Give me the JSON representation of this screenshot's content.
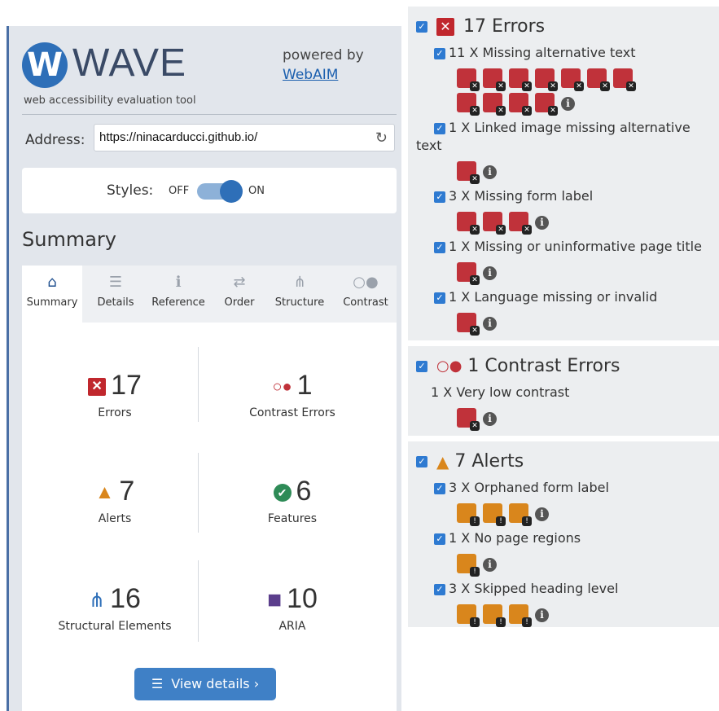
{
  "brand": {
    "logo_letter": "W",
    "title": "WAVE",
    "tagline": "web accessibility evaluation tool",
    "powered_by": "powered by",
    "webaim_link": "WebAIM"
  },
  "address": {
    "label": "Address:",
    "value": "https://ninacarducci.github.io/"
  },
  "styles": {
    "label": "Styles:",
    "off": "OFF",
    "on": "ON",
    "state": "on"
  },
  "summary_heading": "Summary",
  "tabs": [
    {
      "label": "Summary",
      "icon": "home-icon",
      "glyph": "⌂"
    },
    {
      "label": "Details",
      "icon": "list-icon",
      "glyph": "☰"
    },
    {
      "label": "Reference",
      "icon": "info-icon",
      "glyph": "ℹ"
    },
    {
      "label": "Order",
      "icon": "order-icon",
      "glyph": "⇄"
    },
    {
      "label": "Structure",
      "icon": "structure-icon",
      "glyph": "⋔"
    },
    {
      "label": "Contrast",
      "icon": "contrast-icon",
      "glyph": "○●"
    }
  ],
  "stats": {
    "errors": {
      "value": "17",
      "label": "Errors",
      "glyph": "✕"
    },
    "contrast": {
      "value": "1",
      "label": "Contrast Errors",
      "glyph": "○●"
    },
    "alerts": {
      "value": "7",
      "label": "Alerts",
      "glyph": "▲"
    },
    "features": {
      "value": "6",
      "label": "Features",
      "glyph": "✔"
    },
    "structural": {
      "value": "16",
      "label": "Structural Elements",
      "glyph": "⋔"
    },
    "aria": {
      "value": "10",
      "label": "ARIA",
      "glyph": "■"
    }
  },
  "view_details": "View details ›",
  "colors": {
    "error": "#c0323a",
    "alert": "#d9861c",
    "accent": "#2e6fb8",
    "feature": "#2e8b57",
    "aria": "#5b3e8c"
  },
  "right": {
    "errors": {
      "heading": "17 Errors",
      "items": [
        {
          "text": "11 X Missing alternative text",
          "count": 11
        },
        {
          "text": "1 X Linked image missing alternative text",
          "count": 1
        },
        {
          "text": "3 X Missing form label",
          "count": 3
        },
        {
          "text": "1 X Missing or uninformative page title",
          "count": 1
        },
        {
          "text": "1 X Language missing or invalid",
          "count": 1
        }
      ]
    },
    "contrast": {
      "heading": "1 Contrast Errors",
      "items": [
        {
          "text": "1 X Very low contrast",
          "count": 1
        }
      ]
    },
    "alerts": {
      "heading": "7 Alerts",
      "items": [
        {
          "text": "3 X Orphaned form label",
          "count": 3
        },
        {
          "text": "1 X No page regions",
          "count": 1
        },
        {
          "text": "3 X Skipped heading level",
          "count": 3
        }
      ]
    }
  }
}
